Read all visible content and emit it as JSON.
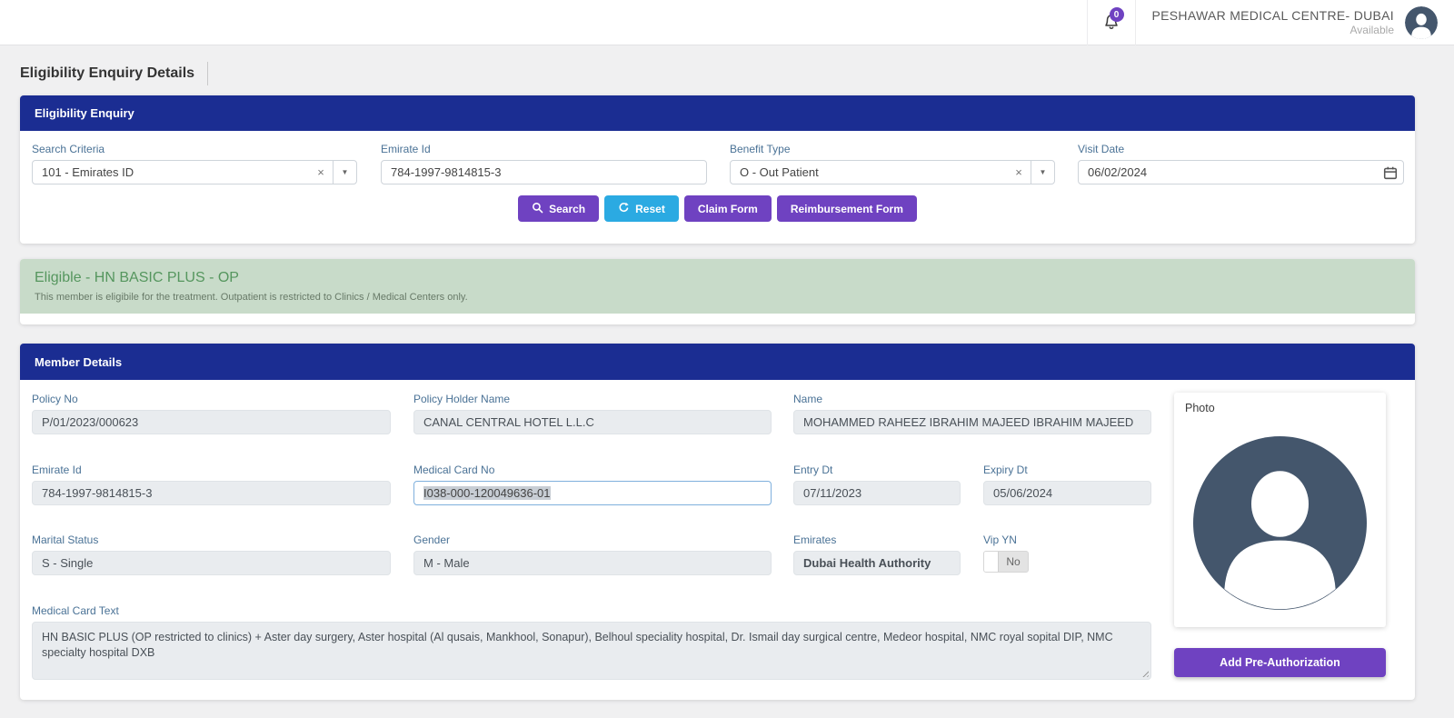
{
  "header": {
    "clinic_name": "PESHAWAR MEDICAL CENTRE- DUBAI",
    "status": "Available",
    "notification_count": "0"
  },
  "page": {
    "title": "Eligibility Enquiry Details"
  },
  "icons": {
    "clear_glyph": "×",
    "caret_glyph": "▼"
  },
  "enquiry": {
    "panel_title": "Eligibility Enquiry",
    "fields": {
      "search_criteria": {
        "label": "Search Criteria",
        "value": "101 - Emirates ID"
      },
      "emirate_id": {
        "label": "Emirate Id",
        "value": "784-1997-9814815-3"
      },
      "benefit_type": {
        "label": "Benefit Type",
        "value": "O - Out Patient"
      },
      "visit_date": {
        "label": "Visit Date",
        "value": "06/02/2024"
      }
    },
    "buttons": {
      "search": "Search",
      "reset": "Reset",
      "claim_form": "Claim Form",
      "reimbursement_form": "Reimbursement Form"
    }
  },
  "eligibility_result": {
    "title": "Eligible - HN BASIC PLUS - OP",
    "message": "This member is eligibile for the treatment. Outpatient is restricted to Clinics / Medical Centers only."
  },
  "member_details": {
    "panel_title": "Member Details",
    "fields": {
      "policy_no": {
        "label": "Policy No",
        "value": "P/01/2023/000623"
      },
      "policy_holder_name": {
        "label": "Policy Holder Name",
        "value": "CANAL CENTRAL HOTEL L.L.C"
      },
      "name": {
        "label": "Name",
        "value": "MOHAMMED RAHEEZ IBRAHIM MAJEED IBRAHIM MAJEED"
      },
      "emirate_id": {
        "label": "Emirate Id",
        "value": "784-1997-9814815-3"
      },
      "medical_card_no": {
        "label": "Medical Card No",
        "value": "I038-000-120049636-01"
      },
      "entry_dt": {
        "label": "Entry Dt",
        "value": "07/11/2023"
      },
      "expiry_dt": {
        "label": "Expiry Dt",
        "value": "05/06/2024"
      },
      "marital_status": {
        "label": "Marital Status",
        "value": "S - Single"
      },
      "gender": {
        "label": "Gender",
        "value": "M - Male"
      },
      "emirates": {
        "label": "Emirates",
        "value": "Dubai Health Authority"
      },
      "vip_yn": {
        "label": "Vip YN",
        "value": "No"
      },
      "medical_card_text": {
        "label": "Medical Card Text",
        "value": "HN BASIC PLUS (OP restricted to clinics) + Aster day surgery, Aster hospital (Al qusais, Mankhool, Sonapur), Belhoul speciality hospital, Dr. Ismail day surgical centre, Medeor hospital, NMC royal sopital DIP,  NMC specialty hospital DXB"
      }
    },
    "photo_label": "Photo",
    "add_preauth_label": "Add Pre-Authorization"
  },
  "colors": {
    "header_navy": "#1b2d92",
    "button_purple": "#6f42c1",
    "reset_blue": "#2baae2",
    "alert_bg": "#c8dbc9",
    "alert_title_green": "#55965e",
    "emirates_red": "#e1262d",
    "label_blue": "#4a7296",
    "avatar_slate": "#44566c",
    "badge_purple": "#6f42c1"
  }
}
